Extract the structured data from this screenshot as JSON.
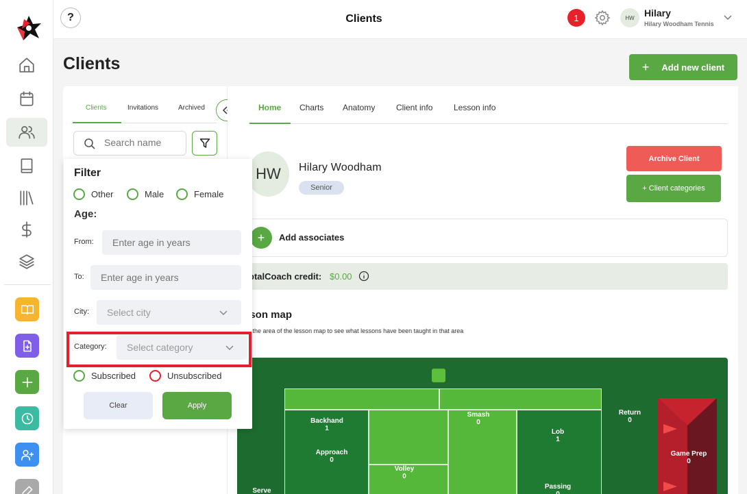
{
  "header": {
    "title": "Clients",
    "help_label": "?",
    "notification_count": "1",
    "user_initials": "HW",
    "user_name": "Hilary",
    "user_org": "Hilary Woodham Tennis"
  },
  "page": {
    "title": "Clients",
    "add_client_plus": "+",
    "add_client_label": "Add new client"
  },
  "list_tabs": [
    "Clients",
    "Invitations",
    "Archived"
  ],
  "search": {
    "placeholder": "Search name"
  },
  "filter": {
    "title": "Filter",
    "gender_options": [
      "Other",
      "Male",
      "Female"
    ],
    "age_label": "Age:",
    "from_label": "From:",
    "from_placeholder": "Enter age in years",
    "to_label": "To:",
    "to_placeholder": "Enter age in years",
    "city_label": "City:",
    "city_placeholder": "Select city",
    "category_label": "Category:",
    "category_placeholder": "Select category",
    "subscription_options": [
      "Subscribed",
      "Unsubscribed"
    ],
    "clear_label": "Clear",
    "apply_label": "Apply"
  },
  "detail_tabs": [
    "Home",
    "Charts",
    "Anatomy",
    "Client info",
    "Lesson info"
  ],
  "client": {
    "initials": "HW",
    "name": "Hilary Woodham",
    "badge": "Senior",
    "archive_label": "Archive Client",
    "categories_label": "+ Client categories",
    "associates_plus": "+",
    "associates_label": "Add associates",
    "credit_label": "otalCoach credit:",
    "credit_value": "$0.00",
    "lesson_map_title": "sson map",
    "lesson_map_sub": "on the area of the lesson map to see what lessons have been taught in that area"
  },
  "lesson_map": {
    "zones": [
      {
        "name": "Backhand",
        "value": "1"
      },
      {
        "name": "Approach",
        "value": "0"
      },
      {
        "name": "Smash",
        "value": "0"
      },
      {
        "name": "Volley",
        "value": "0"
      },
      {
        "name": "Lob",
        "value": "1"
      },
      {
        "name": "Passing",
        "value": "0"
      },
      {
        "name": "Return",
        "value": "0"
      },
      {
        "name": "Game Prep",
        "value": "0"
      },
      {
        "name": "Serve",
        "value": ""
      }
    ]
  },
  "colors": {
    "accent_green": "#5aa844",
    "danger_red": "#ef5b57",
    "highlight_red": "#e5202c",
    "court_green": "#1d6b2f"
  }
}
